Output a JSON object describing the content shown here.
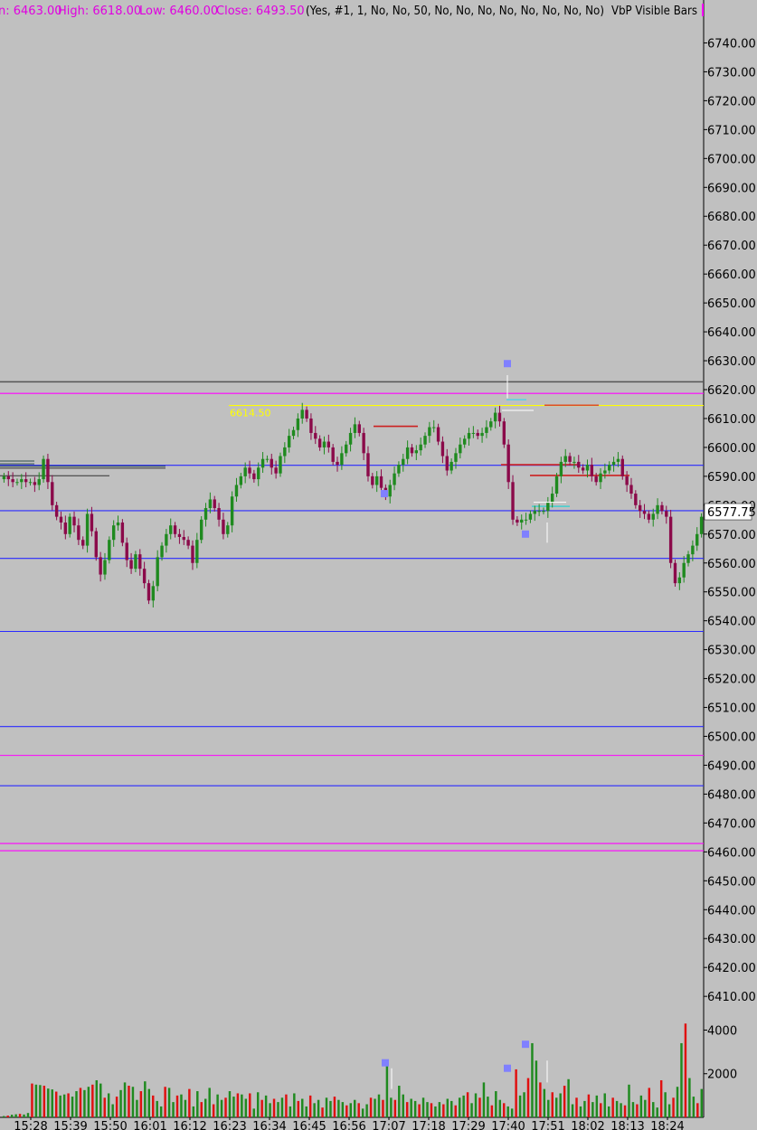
{
  "header": {
    "open_label": "n: 6463.00",
    "high_label": "High: 6618.00",
    "low_label": "Low: 6460.00",
    "close_label": "Close: 6493.50",
    "params": "(Yes, #1, 1, No, No, 50, No, No, No, No, No, No, No, No)",
    "study": "VbP Visible Bars"
  },
  "colors": {
    "background": "#c0c0c0",
    "up_candle": "#1f8a1f",
    "down_candle": "#8b0a4a",
    "header_ohlc": "#e000e0",
    "blue_level": "#2a2aff",
    "magenta_level": "#ff00ff",
    "gray_level": "#555555",
    "yellow_level": "#ffff00",
    "volume_up": "#1f8a1f",
    "volume_down": "#e01010",
    "marker": "#8080ff"
  },
  "chart_data": {
    "type": "candlestick",
    "price_axis": {
      "ticks": [
        "6740.00",
        "6730.00",
        "6720.00",
        "6710.00",
        "6700.00",
        "6690.00",
        "6680.00",
        "6670.00",
        "6660.00",
        "6650.00",
        "6640.00",
        "6630.00",
        "6620.00",
        "6610.00",
        "6600.00",
        "6590.00",
        "6580.00",
        "6570.00",
        "6560.00",
        "6550.00",
        "6540.00",
        "6530.00",
        "6520.00",
        "6510.00",
        "6500.00",
        "6490.00",
        "6480.00",
        "6470.00",
        "6460.00",
        "6450.00",
        "6440.00",
        "6430.00",
        "6420.00",
        "6410.00"
      ],
      "range": [
        6405,
        6748
      ]
    },
    "volume_axis": {
      "ticks": [
        "4000",
        "2000"
      ],
      "range": [
        0,
        4600
      ]
    },
    "time_axis": {
      "ticks": [
        "15:28",
        "15:39",
        "15:50",
        "16:01",
        "16:12",
        "16:23",
        "16:34",
        "16:45",
        "16:56",
        "17:07",
        "17:18",
        "17:29",
        "17:40",
        "17:51",
        "18:02",
        "18:13",
        "18:24"
      ]
    },
    "last_price": "6577.75",
    "yellow_level_label": "6614.50",
    "horizontal_levels": [
      {
        "price": 6622.7,
        "color": "gray"
      },
      {
        "price": 6618.7,
        "color": "magenta"
      },
      {
        "price": 6614.5,
        "color": "yellow"
      },
      {
        "price": 6593.8,
        "color": "blue"
      },
      {
        "price": 6578.1,
        "color": "blue"
      },
      {
        "price": 6561.6,
        "color": "blue"
      },
      {
        "price": 6536.3,
        "color": "blue"
      },
      {
        "price": 6503.4,
        "color": "blue"
      },
      {
        "price": 6493.4,
        "color": "magenta"
      },
      {
        "price": 6482.9,
        "color": "blue"
      },
      {
        "price": 6462.9,
        "color": "magenta"
      },
      {
        "price": 6460.4,
        "color": "magenta"
      }
    ],
    "close_series": [
      6590,
      6589,
      6588,
      6588,
      6589,
      6588,
      6588,
      6587,
      6589,
      6596,
      6588,
      6580,
      6576,
      6574,
      6570,
      6576,
      6573,
      6568,
      6566,
      6577,
      6571,
      6562,
      6556,
      6561,
      6568,
      6573,
      6574,
      6567,
      6561,
      6558,
      6563,
      6558,
      6553,
      6547,
      6552,
      6562,
      6566,
      6570,
      6573,
      6570,
      6569,
      6568,
      6566,
      6560,
      6568,
      6575,
      6579,
      6582,
      6579,
      6575,
      6570,
      6573,
      6583,
      6587,
      6590,
      6593,
      6591,
      6589,
      6593,
      6596,
      6596,
      6593,
      6591,
      6597,
      6600,
      6604,
      6606,
      6610,
      6613,
      6610,
      6605,
      6603,
      6600,
      6602,
      6600,
      6595,
      6594,
      6598,
      6601,
      6605,
      6608,
      6605,
      6598,
      6590,
      6587,
      6590,
      6586,
      6583,
      6587,
      6591,
      6594,
      6596,
      6600,
      6598,
      6599,
      6601,
      6604,
      6607,
      6607,
      6602,
      6597,
      6592,
      6595,
      6598,
      6601,
      6603,
      6605,
      6605,
      6604,
      6605,
      6607,
      6609,
      6612,
      6609,
      6601,
      6588,
      6575,
      6574,
      6575,
      6575,
      6577,
      6578,
      6578,
      6578,
      6581,
      6584,
      6590,
      6595,
      6597,
      6595,
      6595,
      6593,
      6592,
      6594,
      6590,
      6588,
      6591,
      6592,
      6594,
      6595,
      6596,
      6590,
      6587,
      6584,
      6580,
      6578,
      6577,
      6575,
      6577,
      6580,
      6578,
      6576,
      6560,
      6553,
      6555,
      6560,
      6563,
      6566,
      6570,
      6576
    ],
    "volumes": [
      60,
      80,
      120,
      140,
      160,
      130,
      200,
      1550,
      1500,
      1480,
      1450,
      1320,
      1280,
      1180,
      1000,
      1050,
      1100,
      950,
      1200,
      1350,
      1250,
      1400,
      1500,
      1700,
      1550,
      900,
      1100,
      600,
      950,
      1250,
      1600,
      1450,
      1400,
      800,
      1200,
      1650,
      1300,
      1000,
      750,
      500,
      1400,
      1350,
      700,
      1000,
      1050,
      800,
      1300,
      500,
      1200,
      700,
      850,
      1350,
      600,
      1050,
      800,
      900,
      1200,
      950,
      1100,
      1050,
      850,
      1100,
      400,
      1150,
      800,
      1000,
      650,
      850,
      700,
      900,
      1050,
      500,
      1100,
      750,
      850,
      500,
      1000,
      650,
      800,
      450,
      900,
      750,
      950,
      800,
      700,
      550,
      650,
      800,
      650,
      400,
      600,
      900,
      850,
      1050,
      800,
      2550,
      900,
      800,
      1450,
      1050,
      700,
      850,
      750,
      600,
      900,
      700,
      650,
      500,
      700,
      600,
      850,
      750,
      550,
      900,
      1000,
      1150,
      650,
      1100,
      900,
      1600,
      950,
      550,
      1200,
      800,
      650,
      500,
      400,
      2200,
      1000,
      1150,
      1800,
      3400,
      2600,
      1600,
      1300,
      800,
      1150,
      900,
      1100,
      1450,
      1750,
      600,
      900,
      500,
      750,
      1050,
      700,
      1000,
      650,
      1100,
      500,
      900,
      750,
      650,
      550,
      1500,
      700,
      600,
      1000,
      800,
      1350,
      700,
      450,
      1700,
      1150,
      600,
      900,
      1400,
      3400,
      4300,
      1800,
      950,
      650,
      1300
    ]
  }
}
